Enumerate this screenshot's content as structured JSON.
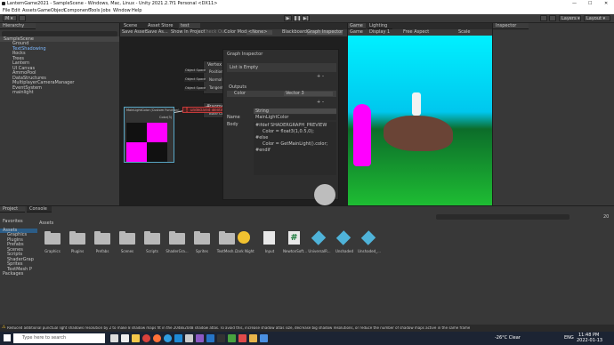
{
  "window": {
    "title": "LanternGame2021 - SampleScene - Windows, Mac, Linux - Unity 2021.2.7f1 Personal <DX11>"
  },
  "menu": [
    "File",
    "Edit",
    "Assets",
    "GameObject",
    "Component",
    "Tools",
    "Jobs",
    "Window",
    "Help"
  ],
  "toolbar": {
    "account": "M",
    "layers": "Layers",
    "layout": "Layout"
  },
  "hierarchy": {
    "tab": "Hierarchy",
    "scene": "SampleScene",
    "items": [
      "Ground",
      "TextShadowing",
      "Rocks",
      "Trees",
      "Lantern",
      "UI Canvas",
      "AmmoPool",
      "DataStructures",
      "MultiplayerCameraManager",
      "EventSystem",
      "mainlight"
    ]
  },
  "graph_tabs": [
    "Scene",
    "Asset Store",
    "test"
  ],
  "graph_toolbar": {
    "save": "Save Asset",
    "save_as": "Save As...",
    "show": "Show In Project",
    "check": "Check Out",
    "color_mode": "Color Mode",
    "color_value": "<None>",
    "blackboard": "Blackboard",
    "inspector": "Graph Inspector",
    "preview": "Main Preview"
  },
  "vertex": {
    "title": "Vertex",
    "ports": [
      "Object Space",
      "Object Space",
      "Object Space"
    ],
    "outs": [
      "Position",
      "Normal",
      "Tangent"
    ]
  },
  "fragment": {
    "title": "Fragment",
    "out": "Base Color"
  },
  "custom_node": {
    "title": "MainLightColor (Custom Function)",
    "out": "Color(3)"
  },
  "error": "undeclared identifier 'Color' at line 123 (on d3d11)",
  "graph_inspector": {
    "title": "Graph Inspector",
    "list_empty": "List is Empty",
    "outputs": "Outputs",
    "output_name": "Color",
    "output_type": "Vector 3",
    "type": "String",
    "name_label": "Name",
    "name_value": "MainLightColor",
    "body_label": "Body",
    "body_lines": [
      "#ifdef SHADERGRAPH_PREVIEW",
      "Color = float3(1,0.5,0);",
      "#else",
      "Color = GetMainLight().color;",
      "#endif"
    ]
  },
  "game": {
    "tabs": [
      "Game",
      "Lighting"
    ],
    "display": "Display 1",
    "aspect": "Free Aspect",
    "scale": "Scale"
  },
  "inspector": {
    "tab": "Inspector"
  },
  "project": {
    "tabs": [
      "Project",
      "Console"
    ],
    "breadcrumb": "Assets",
    "count": "20",
    "tree": [
      "Favorites",
      "Assets",
      "Graphics",
      "Plugins",
      "Prefabs",
      "Scenes",
      "Scripts",
      "ShaderGrap",
      "Sprites",
      "TextMesh P",
      "Packages"
    ],
    "assets": [
      "Graphics",
      "Plugins",
      "Prefabs",
      "Scenes",
      "Scripts",
      "ShaderGra...",
      "Sprites",
      "TextMesh...",
      "Dark Night",
      "Input",
      "NewtonSoft...",
      "UniversalR...",
      "Unshaded",
      "Unshaded_..."
    ]
  },
  "status": "Reduced additional punctual light shadows resolution by 2 to make 8 shadow maps fit in the 2048x2048 shadow atlas. To avoid this, increase shadow atlas size, decrease big shadow resolutions, or reduce the number of shadow maps active in the same frame",
  "taskbar": {
    "search": "Type here to search",
    "weather": "-26°C  Clear",
    "lang": "ENG",
    "time": "11:48 PM",
    "date": "2022-01-13"
  },
  "colors": {
    "magenta": "#ff00ff",
    "sky": "#00e5ff",
    "ground": "#1ebd33",
    "error": "#c43a3a"
  }
}
